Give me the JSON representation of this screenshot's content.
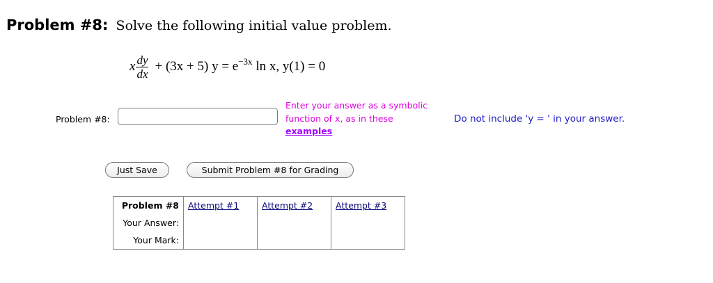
{
  "heading": {
    "number": "Problem #8:",
    "description": "Solve the following initial value problem."
  },
  "equation": {
    "x": "x",
    "frac_top": "dy",
    "frac_bottom": "dx",
    "rest_1": "+ (3x + 5) y  =  e",
    "exponent": "−3x",
    "rest_2": " ln x,   y(1)  =  0"
  },
  "answer": {
    "label": "Problem #8:",
    "value": "",
    "placeholder": ""
  },
  "hint": {
    "line1": "Enter your answer as a symbolic",
    "line2": "function of x, as in these",
    "link": "examples"
  },
  "note": "Do not include 'y = ' in your answer.",
  "buttons": {
    "save": "Just Save",
    "submit": "Submit Problem #8 for Grading"
  },
  "attempts": {
    "header": "Problem #8",
    "columns": [
      "Attempt #1",
      "Attempt #2",
      "Attempt #3"
    ],
    "rows": [
      "Your Answer:",
      "Your Mark:"
    ]
  },
  "colors": {
    "hint": "#e000e0",
    "link": "#a000ff",
    "note": "#1d1dc8"
  }
}
